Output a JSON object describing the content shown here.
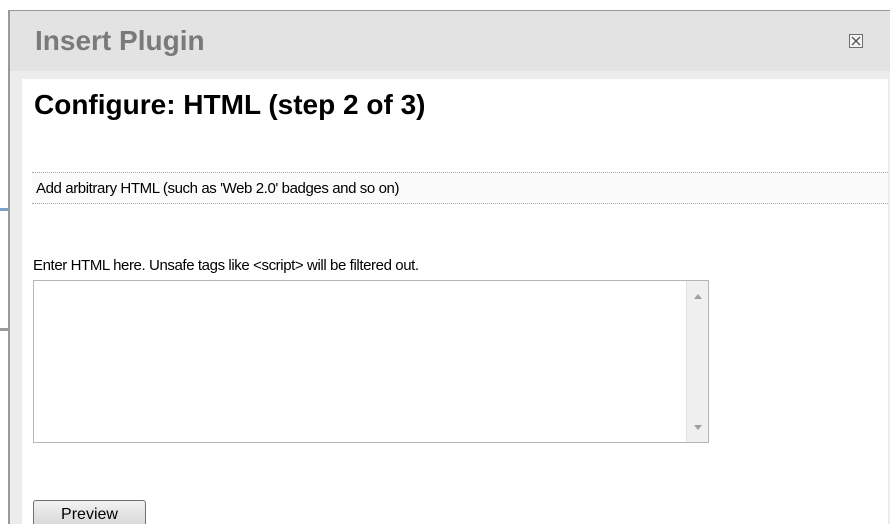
{
  "dialog": {
    "title": "Insert Plugin",
    "close_icon": "close-box-icon"
  },
  "step": {
    "title": "Configure: HTML (step 2 of 3)"
  },
  "plugin": {
    "description": "Add arbitrary HTML (such as 'Web 2.0' badges and so on)"
  },
  "html_field": {
    "label": "Enter HTML here. Unsafe tags like <script> will be filtered out.",
    "value": ""
  },
  "actions": {
    "preview_label": "Preview"
  },
  "colors": {
    "titlebar": "#e3e3e3",
    "title_text": "#7a7a7a",
    "content_bg": "#ffffff"
  }
}
